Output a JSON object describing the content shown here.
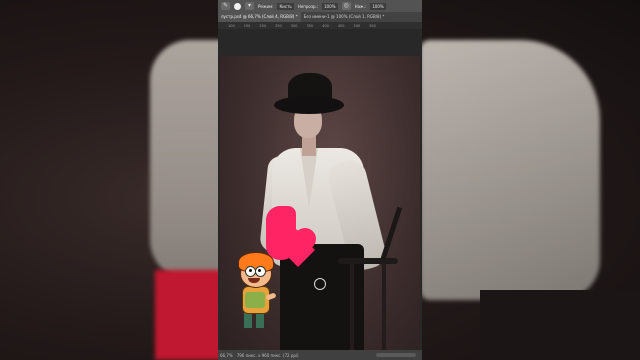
{
  "options_bar": {
    "mode_label": "Режим:",
    "mode_value": "Кисть",
    "opacity_label": "Непрозр.:",
    "opacity_value": "100%",
    "flow_label": "Наж.:",
    "flow_value": "100%"
  },
  "tabs": [
    {
      "label": "лустр.psd @ 66,7% (Слой 4, RGB/8) *",
      "active": true
    },
    {
      "label": "Без имени-1 @ 100% (Слой 1, RGB/8) *",
      "active": false
    }
  ],
  "ruler_ticks": [
    "100",
    "150",
    "200",
    "250",
    "300",
    "350",
    "400",
    "450",
    "500",
    "550"
  ],
  "status_bar": {
    "zoom": "66,7%",
    "doc_info": "796 пикс. x 960 пикс. (72 ppi)"
  },
  "colors": {
    "accent_pink": "#ff2464",
    "panel_bg": "#3c3c3c"
  }
}
